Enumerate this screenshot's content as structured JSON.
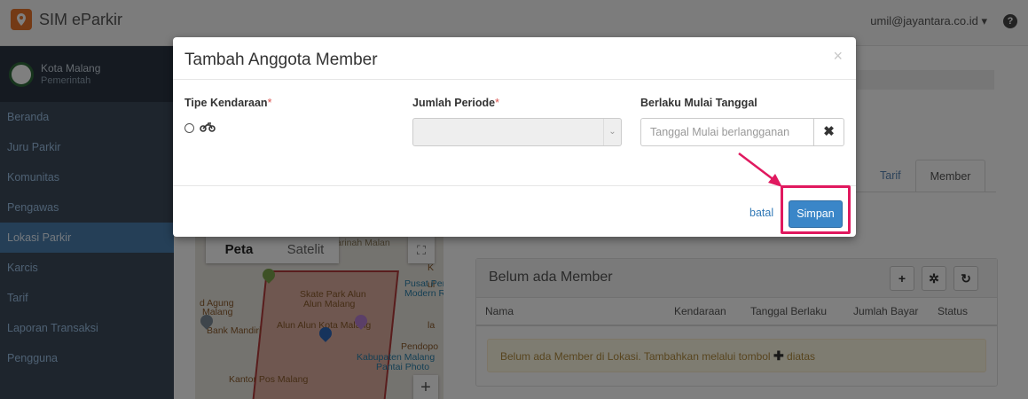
{
  "app": {
    "title": "SIM eParkir"
  },
  "user": {
    "email": "umil@jayantara.co.id ▾"
  },
  "org": {
    "name": "Kota Malang",
    "sub": "Pemerintah"
  },
  "sidebar": {
    "items": [
      {
        "label": "Beranda",
        "active": false
      },
      {
        "label": "Juru Parkir",
        "active": false
      },
      {
        "label": "Komunitas",
        "active": false
      },
      {
        "label": "Pengawas",
        "active": false
      },
      {
        "label": "Lokasi Parkir",
        "active": true
      },
      {
        "label": "Karcis",
        "active": false
      },
      {
        "label": "Tarif",
        "active": false
      },
      {
        "label": "Laporan Transaksi",
        "active": false
      },
      {
        "label": "Pengguna",
        "active": false
      }
    ]
  },
  "tabs": {
    "tarif": "Tarif",
    "member": "Member"
  },
  "map": {
    "peta": "Peta",
    "satelit": "Satelit",
    "labels": {
      "skate": "Skate Park Alun",
      "alun": "Alun Malang",
      "agung": "d Agung",
      "malang": "Malang",
      "bank": "Bank Mandiri",
      "alunkota": "Alun Alun Kota Malang",
      "kabupaten": "Kabupaten Malang",
      "pantai": "Pantai Photo",
      "pusat": "Pusat Perb",
      "modern": "Modern Ra",
      "kantor": "Kantor Pos Malang",
      "sarinah": "Sarinah Malan",
      "pendopo": "Pendopo",
      "ul": "ul",
      "k": "K",
      "la": "la"
    }
  },
  "member_panel": {
    "title": "Belum ada Member",
    "columns": [
      "Nama",
      "Kendaraan",
      "Tanggal Berlaku",
      "Jumlah Bayar",
      "Status"
    ],
    "alert_before": "Belum ada Member di Lokasi. Tambahkan melalui tombol",
    "alert_after": "diatas"
  },
  "modal": {
    "title": "Tambah Anggota Member",
    "close": "×",
    "fields": {
      "tipe_kendaraan": "Tipe Kendaraan",
      "jumlah_periode": "Jumlah Periode",
      "berlaku_mulai": "Berlaku Mulai Tanggal",
      "required_mark": "*"
    },
    "date_placeholder": "Tanggal Mulai berlangganan",
    "batal": "batal",
    "simpan": "Simpan"
  },
  "colors": {
    "highlight": "#e0195f",
    "primary": "#3a86c8",
    "sidebar": "#3c4b5a",
    "active": "#4a7fae"
  }
}
